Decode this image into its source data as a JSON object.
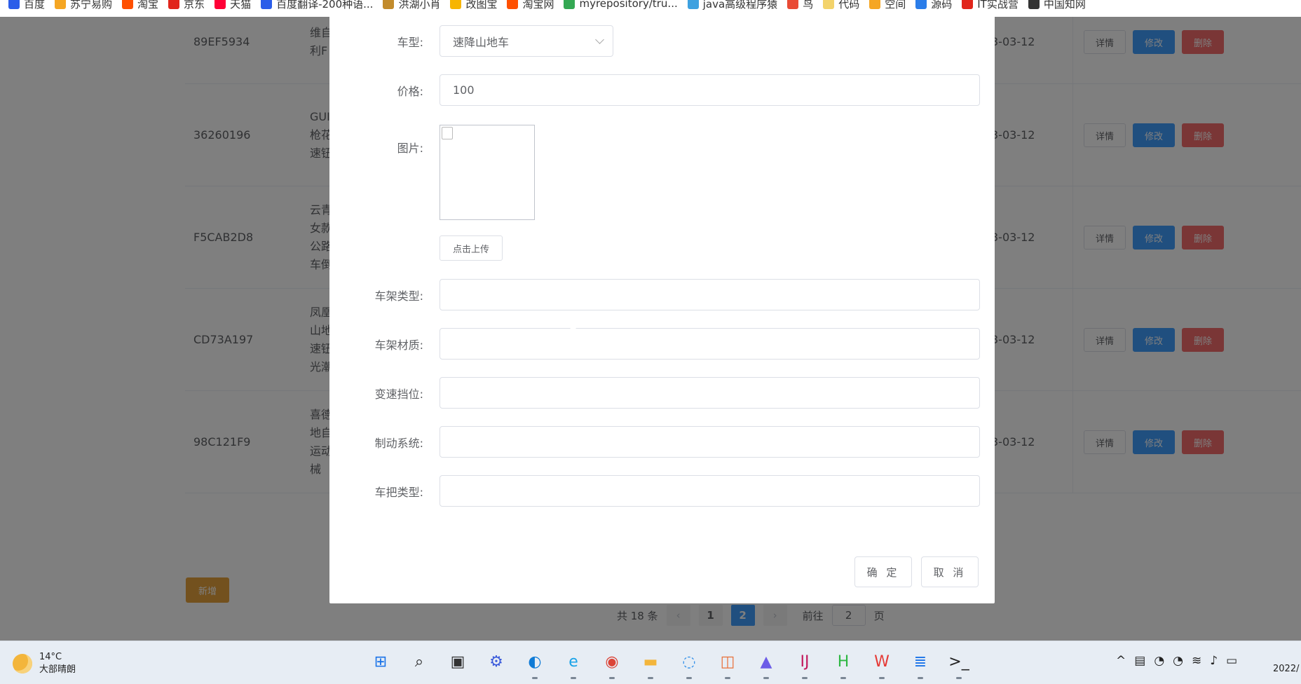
{
  "bookmarks": [
    {
      "label": "百度",
      "color": "#2b5de9"
    },
    {
      "label": "苏宁易购",
      "color": "#f5a623"
    },
    {
      "label": "淘宝",
      "color": "#ff5000"
    },
    {
      "label": "京东",
      "color": "#e1251b"
    },
    {
      "label": "天猫",
      "color": "#ff0036"
    },
    {
      "label": "百度翻译-200种语...",
      "color": "#2b5de9"
    },
    {
      "label": "洪湖小肖",
      "color": "#c28b2c"
    },
    {
      "label": "改图宝",
      "color": "#f7b500"
    },
    {
      "label": "淘宝网",
      "color": "#ff5000"
    },
    {
      "label": "myrepository/tru...",
      "color": "#34a853"
    },
    {
      "label": "java高级程序猿",
      "color": "#3da1e0"
    },
    {
      "label": "鸟",
      "color": "#e94b35"
    },
    {
      "label": "代码",
      "color": "#f3d36b"
    },
    {
      "label": "空间",
      "color": "#f5a623"
    },
    {
      "label": "源码",
      "color": "#2b7de9"
    },
    {
      "label": "IT实战营",
      "color": "#e1251b"
    },
    {
      "label": "中国知网",
      "color": "#333333"
    }
  ],
  "table": {
    "rows": [
      {
        "code": "89EF5934",
        "name": "维自\n利F",
        "date": "3-03-12"
      },
      {
        "code": "36260196",
        "name": "GUI\n枪花\n速钮",
        "date": "3-03-12"
      },
      {
        "code": "F5CAB2D8",
        "name": "云青\n女款\n公路\n车倒",
        "date": "3-03-12"
      },
      {
        "code": "CD73A197",
        "name": "凤凰\n山地\n速钮\n光潮",
        "date": "3-03-12"
      },
      {
        "code": "98C121F9",
        "name": "喜德\n地自\n运动\n械",
        "date": "3-03-12"
      }
    ],
    "op_detail": "详情",
    "op_edit": "修改",
    "op_delete": "删除"
  },
  "add_button": "新增",
  "pager": {
    "total": "共 18 条",
    "prev": "‹",
    "pages": [
      "1",
      "2"
    ],
    "active": "2",
    "next": "›",
    "goto_prefix": "前往",
    "goto_value": "2",
    "goto_suffix": "页"
  },
  "dialog": {
    "type_label": "车型:",
    "type_value": "速降山地车",
    "price_label": "价格:",
    "price_value": "100",
    "image_label": "图片:",
    "upload_label": "点击上传",
    "frame_type_label": "车架类型:",
    "frame_material_label": "车架材质:",
    "gear_label": "变速挡位:",
    "brake_label": "制动系统:",
    "handlebar_label": "车把类型:",
    "confirm_label": "确 定",
    "cancel_label": "取 消"
  },
  "taskbar": {
    "temperature": "14°C",
    "weather": "大部晴朗",
    "clock": "2022/",
    "apps": [
      {
        "name": "start-icon",
        "glyph": "⊞",
        "color": "#1a73e8"
      },
      {
        "name": "search-icon",
        "glyph": "⌕",
        "color": "#222222"
      },
      {
        "name": "task-view-icon",
        "glyph": "▣",
        "color": "#333333"
      },
      {
        "name": "network-app-icon",
        "glyph": "⚙",
        "color": "#3b5bdb"
      },
      {
        "name": "edge-icon",
        "glyph": "◐",
        "color": "#0f7bd6"
      },
      {
        "name": "ie-icon",
        "glyph": "e",
        "color": "#1aa3e8"
      },
      {
        "name": "chrome-icon",
        "glyph": "◉",
        "color": "#db4437"
      },
      {
        "name": "file-explorer-icon",
        "glyph": "▬",
        "color": "#f3b53b"
      },
      {
        "name": "photos-icon",
        "glyph": "◌",
        "color": "#2b8de9"
      },
      {
        "name": "slides-icon",
        "glyph": "◫",
        "color": "#e8703a"
      },
      {
        "name": "paint-icon",
        "glyph": "▲",
        "color": "#6c5ce7"
      },
      {
        "name": "intellij-icon",
        "glyph": "IJ",
        "color": "#c2185b"
      },
      {
        "name": "hbuilder-icon",
        "glyph": "H",
        "color": "#2db742"
      },
      {
        "name": "wps-icon",
        "glyph": "W",
        "color": "#e53935"
      },
      {
        "name": "notepad-icon",
        "glyph": "≣",
        "color": "#1a73e8"
      },
      {
        "name": "terminal-icon",
        "glyph": ">_",
        "color": "#222222"
      }
    ],
    "tray": [
      "^",
      "▤",
      "◔",
      "◔",
      "≋",
      "♪",
      "▭"
    ]
  }
}
